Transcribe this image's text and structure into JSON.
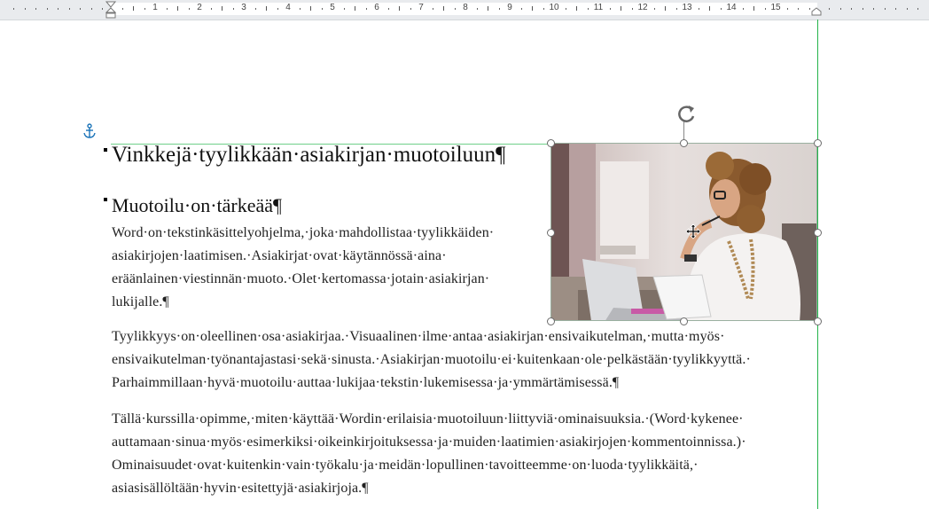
{
  "ruler": {
    "numbers": [
      "1",
      "2",
      "3",
      "4",
      "5",
      "6",
      "7",
      "8",
      "9",
      "10",
      "11",
      "12",
      "13",
      "14",
      "15"
    ]
  },
  "document": {
    "heading1": "Vinkkejä·tyylikkään·asiakirjan·muotoiluun¶",
    "heading2": "Muotoilu·on·tärkeää¶",
    "paragraph1": [
      "Word·on·tekstinkäsittelyohjelma,·joka·mahdollistaa·tyylikkäiden·",
      "asiakirjojen·laatimisen.·Asiakirjat·ovat·käytännössä·aina·",
      "eräänlainen·viestinnän·muoto.·Olet·kertomassa·jotain·asiakirjan·",
      "lukijalle.¶"
    ],
    "paragraph2": [
      "Tyylikkyys·on·oleellinen·osa·asiakirjaa.·Visuaalinen·ilme·antaa·asiakirjan·ensivaikutelman,·mutta·myös·",
      "ensivaikutelman·työnantajastasi·sekä·sinusta.·Asiakirjan·muotoilu·ei·kuitenkaan·ole·pelkästään·tyylikkyyttä.·",
      "Parhaimmillaan·hyvä·muotoilu·auttaa·lukijaa·tekstin·lukemisessa·ja·ymmärtämisessä.¶"
    ],
    "paragraph3": [
      "Tällä·kurssilla·opimme,·miten·käyttää·Wordin·erilaisia·muotoiluun·liittyviä·ominaisuuksia.·(Word·kykenee·",
      "auttamaan·sinua·myös·esimerkiksi·oikeinkirjoituksessa·ja·muiden·laatimien·asiakirjojen·kommentoinnissa.)·",
      "Ominaisuudet·ovat·kuitenkin·vain·työkalu·ja·meidän·lopullinen·tavoitteemme·on·luoda·tyylikkäitä,·",
      "asiasisällöltään·hyvin·esitettyjä·asiakirjoja.¶"
    ]
  },
  "image": {
    "icon": "photo-woman-with-laptop"
  },
  "colors": {
    "margin_guide": "#24b34a",
    "anchor": "#1a73b8"
  }
}
